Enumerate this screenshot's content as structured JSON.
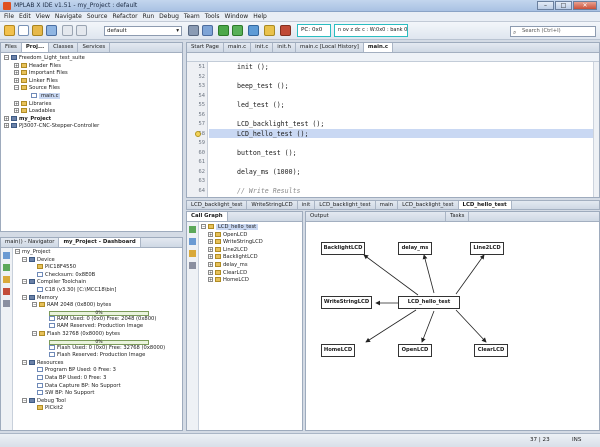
{
  "window": {
    "title": "MPLAB X IDE v1.51 - my_Project : default",
    "minimize": "–",
    "maximize": "□",
    "close": "✕"
  },
  "menu": [
    "File",
    "Edit",
    "View",
    "Navigate",
    "Source",
    "Refactor",
    "Run",
    "Debug",
    "Team",
    "Tools",
    "Window",
    "Help"
  ],
  "toolbar": {
    "config": "default",
    "pc": "PC: 0x0",
    "status": "n ov z dc c : W:0x0 : bank 0",
    "search_placeholder": "Search (Ctrl+I)"
  },
  "left_tabs": [
    "Files",
    "Proj...",
    "Classes",
    "Services"
  ],
  "project_tree": [
    {
      "label": "Freedom_Light_test_suite",
      "depth": 0,
      "icon": "project-icon",
      "bold": false
    },
    {
      "label": "Header Files",
      "depth": 1,
      "icon": "folder-icon"
    },
    {
      "label": "Important Files",
      "depth": 1,
      "icon": "folder-icon"
    },
    {
      "label": "Linker Files",
      "depth": 1,
      "icon": "folder-icon"
    },
    {
      "label": "Source Files",
      "depth": 1,
      "icon": "folder-icon"
    },
    {
      "label": "main.c",
      "depth": 2,
      "icon": "file-icon",
      "selected": true
    },
    {
      "label": "Libraries",
      "depth": 1,
      "icon": "folder-icon"
    },
    {
      "label": "Loadables",
      "depth": 1,
      "icon": "folder-icon"
    },
    {
      "label": "my_Project",
      "depth": 0,
      "icon": "project-icon",
      "bold": true
    },
    {
      "label": "PJ3007-CNC-Stepper-Controller",
      "depth": 0,
      "icon": "project-icon"
    }
  ],
  "editor_tabs": [
    "Start Page",
    "main.c",
    "init.c",
    "init.h",
    "main.c [Local History]",
    "main.c"
  ],
  "editor_lines": [
    {
      "num": "",
      "text": "init ();"
    },
    {
      "num": "",
      "text": ""
    },
    {
      "num": "",
      "text": "beep_test ();"
    },
    {
      "num": "",
      "text": ""
    },
    {
      "num": "",
      "text": "led_test ();"
    },
    {
      "num": "",
      "text": ""
    },
    {
      "num": "",
      "text": "LCD_backlight_test ();"
    },
    {
      "num": "",
      "text": "LCD_hello_test ();",
      "highlight": true
    },
    {
      "num": "",
      "text": ""
    },
    {
      "num": "",
      "text": "button_test ();"
    },
    {
      "num": "",
      "text": ""
    },
    {
      "num": "",
      "text": "delay_ms (1000);"
    },
    {
      "num": "",
      "text": ""
    },
    {
      "num": "",
      "text": "// Write Results",
      "comment": true
    }
  ],
  "line_numbers": [
    "51",
    "52",
    "53",
    "54",
    "55",
    "56",
    "57",
    "58",
    "59",
    "60",
    "61",
    "62",
    "63",
    "64"
  ],
  "nav_tabs": [
    "main() - Navigator",
    "my_Project - Dashboard"
  ],
  "dashboard": [
    {
      "label": "my_Project",
      "depth": 0
    },
    {
      "label": "Device",
      "depth": 1
    },
    {
      "label": "PIC18F4550",
      "depth": 2
    },
    {
      "label": "Checksum: 0x8E0B",
      "depth": 2
    },
    {
      "label": "Compiler Toolchain",
      "depth": 1
    },
    {
      "label": "C18 (v3.30) [C:\\MCC18\\bin]",
      "depth": 2
    },
    {
      "label": "Memory",
      "depth": 1
    },
    {
      "label": "RAM 2048 (0x800) bytes",
      "depth": 2
    },
    {
      "label": "0%",
      "depth": 3,
      "bar": true
    },
    {
      "label": "RAM Used: 0 (0x0) Free: 2048 (0x800)",
      "depth": 3
    },
    {
      "label": "RAM Reserved: Production Image",
      "depth": 3
    },
    {
      "label": "Flash 32768 (0x8000) bytes",
      "depth": 2
    },
    {
      "label": "0%",
      "depth": 3,
      "bar": true
    },
    {
      "label": "Flash Used: 0 (0x0) Free: 32768 (0x8000)",
      "depth": 3
    },
    {
      "label": "Flash Reserved: Production Image",
      "depth": 3
    },
    {
      "label": "Resources",
      "depth": 1
    },
    {
      "label": "Program BP Used: 0 Free: 3",
      "depth": 2
    },
    {
      "label": "Data BP Used: 0 Free: 3",
      "depth": 2
    },
    {
      "label": "Data Capture BP: No Support",
      "depth": 2
    },
    {
      "label": "SW BP: No Support",
      "depth": 2
    },
    {
      "label": "Debug Tool",
      "depth": 1
    },
    {
      "label": "PICkit2",
      "depth": 2
    }
  ],
  "bottom_left_tabs": [
    "LCD_backlight_test",
    "WriteStringLCD",
    "init"
  ],
  "bottom_right_tabs": [
    "LCD_backlight_test",
    "main",
    "LCD_backlight_test",
    "LCD_hello_test"
  ],
  "call_graph": {
    "title": "Call Graph",
    "output": "Output",
    "tasks": "Tasks",
    "root": "LCD_hello_test",
    "children": [
      "OpenLCD",
      "WriteStringLCD",
      "Line2LCD",
      "BacklightLCD",
      "delay_ms",
      "ClearLCD",
      "HomeLCD"
    ],
    "center": "LCD_hello_test",
    "nodes": [
      "BacklightLCD",
      "delay_ms",
      "Line2LCD",
      "WriteStringLCD",
      "HomeLCD",
      "OpenLCD",
      "ClearLCD"
    ]
  },
  "status": {
    "position": "37 | 23",
    "mode": "INS"
  }
}
